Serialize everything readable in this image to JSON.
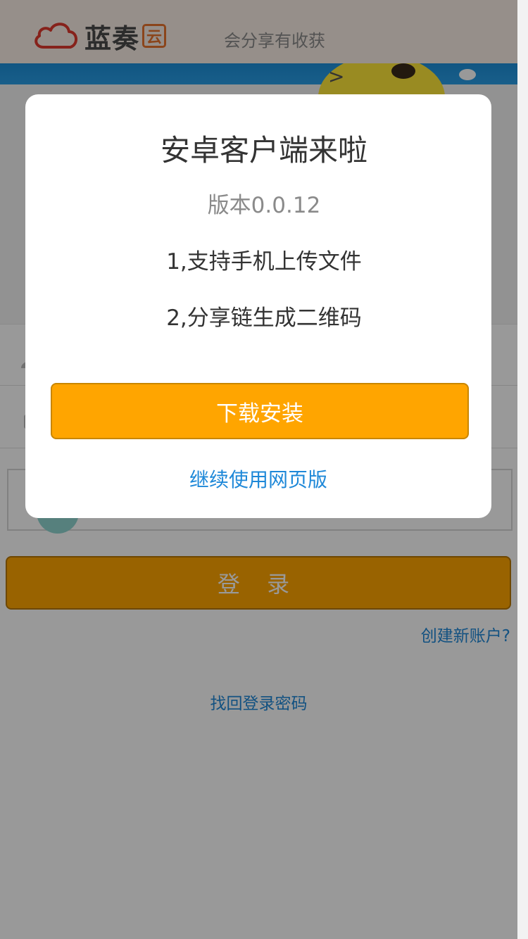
{
  "header": {
    "logo_text": "蓝奏",
    "logo_badge": "云",
    "slogan": "会分享有收获"
  },
  "login": {
    "submit_label": "登 录",
    "create_account": "创建新账户?",
    "forgot_password": "找回登录密码"
  },
  "dialog": {
    "title": "安卓客户端来啦",
    "version": "版本0.0.12",
    "features": [
      "1,支持手机上传文件",
      "2,分享链生成二维码"
    ],
    "download_label": "下载安装",
    "continue_label": "继续使用网页版"
  },
  "colors": {
    "accent": "#ffa500",
    "link": "#1e88d8",
    "overlay": "rgba(0,0,0,0.4)"
  }
}
